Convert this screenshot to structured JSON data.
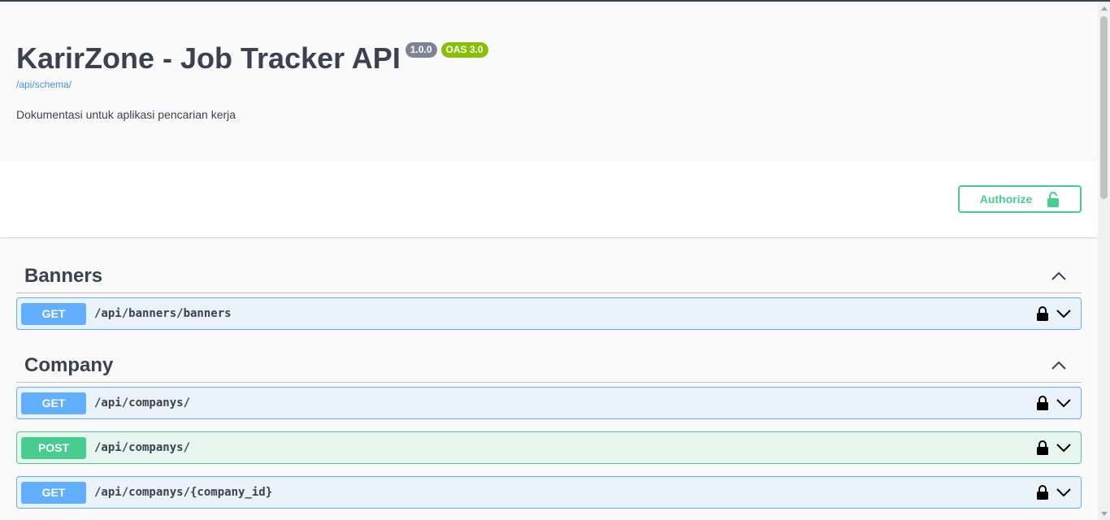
{
  "info": {
    "title": "KarirZone - Job Tracker API",
    "version_badge": "1.0.0",
    "oas_badge": "OAS 3.0",
    "schema_link": "/api/schema/",
    "description": "Dokumentasi untuk aplikasi pencarian kerja"
  },
  "auth": {
    "authorize_label": "Authorize",
    "icon": "lock-open-icon"
  },
  "tags": [
    {
      "name": "Banners",
      "expanded": true,
      "operations": [
        {
          "method": "GET",
          "path": "/api/banners/banners"
        }
      ]
    },
    {
      "name": "Company",
      "expanded": true,
      "operations": [
        {
          "method": "GET",
          "path": "/api/companys/"
        },
        {
          "method": "POST",
          "path": "/api/companys/"
        },
        {
          "method": "GET",
          "path": "/api/companys/{company_id}"
        }
      ]
    }
  ],
  "colors": {
    "get": "#61affe",
    "post": "#49cc90",
    "text": "#3b4151",
    "link": "#4990e2",
    "version_badge": "#7d8492",
    "oas_badge": "#89bf04"
  }
}
